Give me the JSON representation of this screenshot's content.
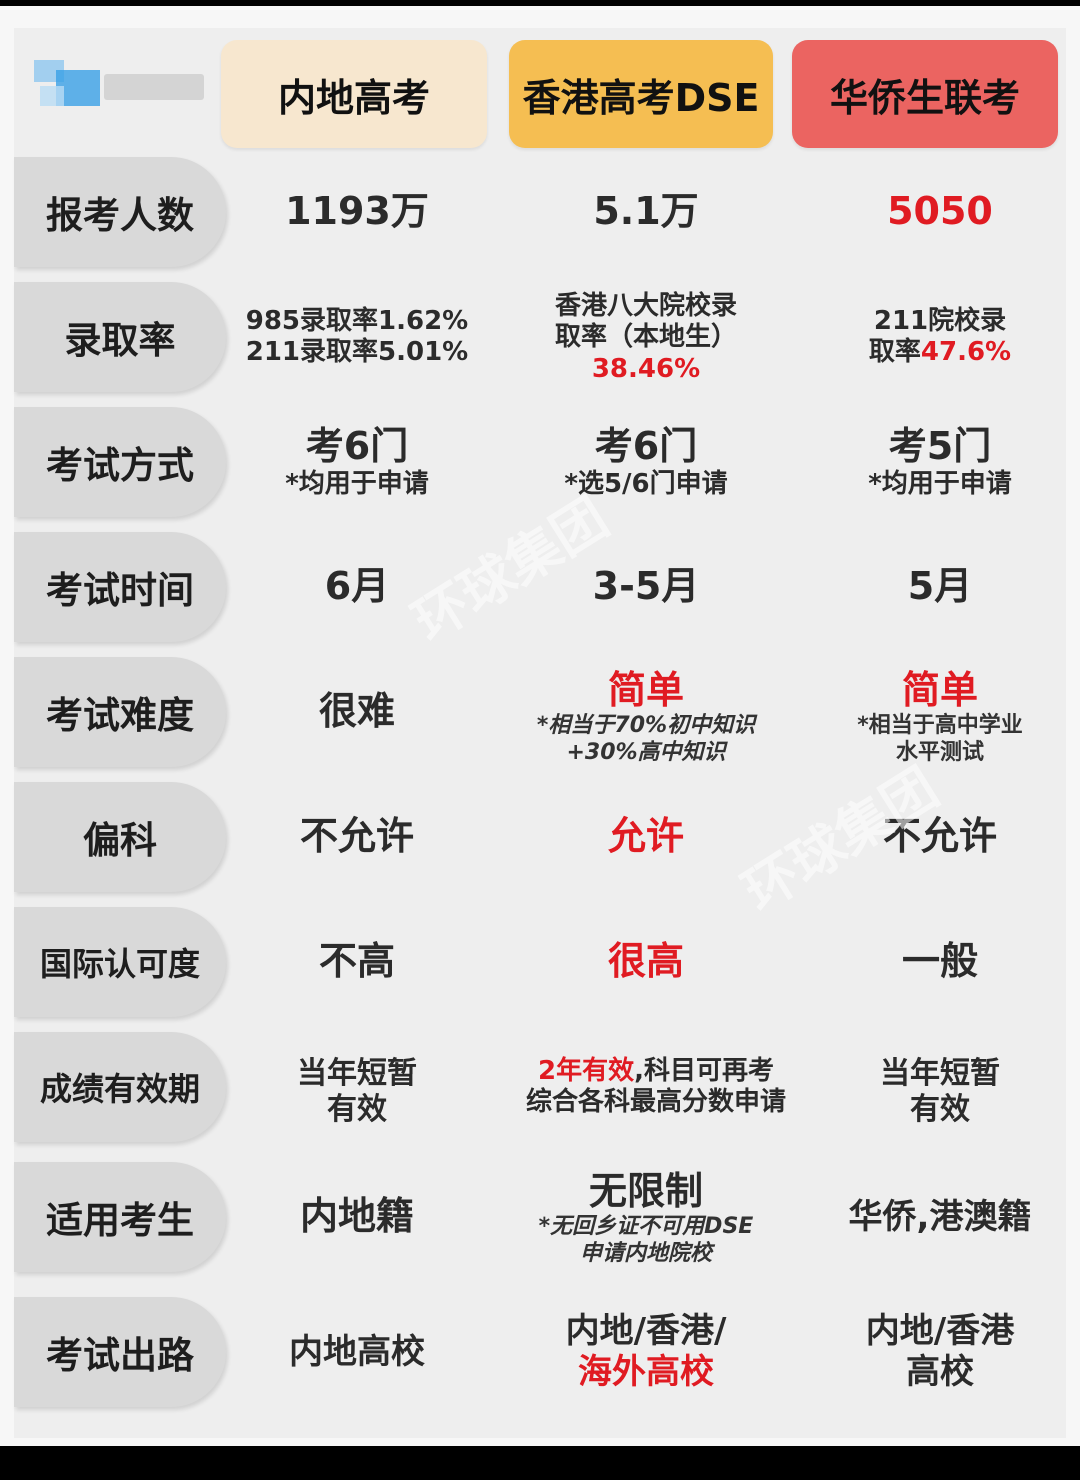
{
  "header": {
    "col1": "内地高考",
    "col2": "香港高考DSE",
    "col3": "华侨生联考"
  },
  "rows": [
    {
      "label": "报考人数",
      "c1": "1193万",
      "c2": "5.1万",
      "c3": "5050"
    },
    {
      "label": "录取率",
      "c1_line1": "985录取率1.62%",
      "c1_line2": "211录取率5.01%",
      "c2_line1": "香港八大院校录",
      "c2_line2": "取率（本地生）",
      "c2_line3": "38.46%",
      "c3_line1": "211院校录",
      "c3_line2_prefix": "取率",
      "c3_line2_value": "47.6%"
    },
    {
      "label": "考试方式",
      "c1": "考6门",
      "c1_note": "*均用于申请",
      "c2": "考6门",
      "c2_note": "*选5/6门申请",
      "c3": "考5门",
      "c3_note": "*均用于申请"
    },
    {
      "label": "考试时间",
      "c1": "6月",
      "c2": "3-5月",
      "c3": "5月"
    },
    {
      "label": "考试难度",
      "c1": "很难",
      "c2": "简单",
      "c2_note1": "*相当于70%初中知识",
      "c2_note2": "+30%高中知识",
      "c3": "简单",
      "c3_note1": "*相当于高中学业",
      "c3_note2": "水平测试"
    },
    {
      "label": "偏科",
      "c1": "不允许",
      "c2": "允许",
      "c3": "不允许"
    },
    {
      "label": "国际认可度",
      "c1": "不高",
      "c2": "很高",
      "c3": "一般"
    },
    {
      "label": "成绩有效期",
      "c1_line1": "当年短暂",
      "c1_line2": "有效",
      "c2_line1_red": "2年有效",
      "c2_line1_rest": ",科目可再考",
      "c2_line2": "综合各科最高分数申请",
      "c3_line1": "当年短暂",
      "c3_line2": "有效"
    },
    {
      "label": "适用考生",
      "c1": "内地籍",
      "c2": "无限制",
      "c2_note1": "*无回乡证不可用DSE",
      "c2_note2": "申请内地院校",
      "c3": "华侨,港澳籍"
    },
    {
      "label": "考试出路",
      "c1": "内地高校",
      "c2_line1": "内地/香港/",
      "c2_line2": "海外高校",
      "c3_line1": "内地/香港",
      "c3_line2": "高校"
    }
  ],
  "watermark": "环球集团",
  "colors": {
    "red": "#e01b22",
    "header1": "#f7e7cf",
    "header2": "#f5be52",
    "header3": "#eb6461",
    "label_bg": "#d9d9d9"
  }
}
